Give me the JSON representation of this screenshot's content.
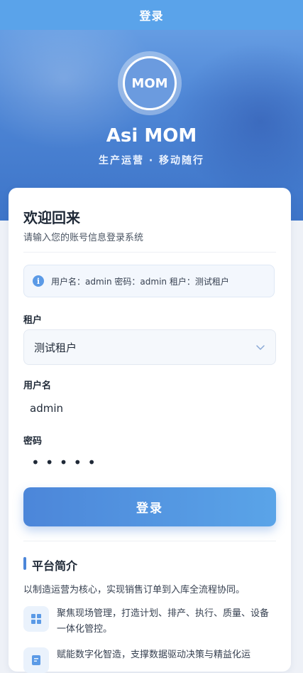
{
  "header": {
    "title": "登录"
  },
  "brand": {
    "logo_text": "MOM",
    "app_name": "Asi MOM",
    "slogan": "生产运营 · 移动随行"
  },
  "welcome": {
    "title": "欢迎回来",
    "subtitle": "请输入您的账号信息登录系统"
  },
  "hint": {
    "text": "用户名：admin 密码：admin 租户：测试租户"
  },
  "form": {
    "tenant_label": "租户",
    "tenant_value": "测试租户",
    "username_label": "用户名",
    "username_value": "admin",
    "password_label": "密码",
    "password_mask": "•••••",
    "login_button": "登录"
  },
  "intro": {
    "title": "平台简介",
    "description": "以制造运营为核心，实现销售订单到入库全流程协同。",
    "features": [
      {
        "icon": "grid-icon",
        "text": "聚焦现场管理，打造计划、排产、执行、质量、设备一体化管控。"
      },
      {
        "icon": "document-icon",
        "text": "赋能数字化智造，支撑数据驱动决策与精益化运"
      }
    ]
  },
  "colors": {
    "primary": "#4c86d9",
    "header": "#5aa3ea"
  }
}
